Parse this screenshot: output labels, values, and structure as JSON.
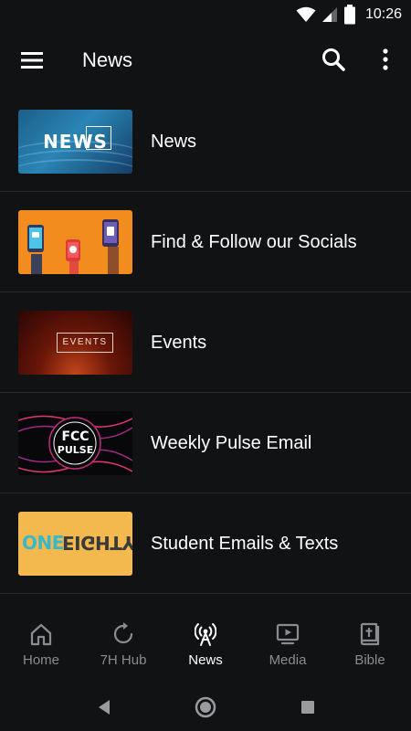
{
  "status_bar": {
    "time": "10:26",
    "icons": [
      "wifi-icon",
      "signal-icon",
      "battery-icon"
    ]
  },
  "app_bar": {
    "title": "News",
    "icons": [
      "menu-icon",
      "search-icon",
      "more-vert-icon"
    ]
  },
  "list": {
    "items": [
      {
        "label": "News",
        "thumb_text": "NEWS"
      },
      {
        "label": "Find & Follow our Socials"
      },
      {
        "label": "Events",
        "thumb_text": "EVENTS"
      },
      {
        "label": "Weekly Pulse Email",
        "thumb_text_line1": "FCC",
        "thumb_text_line2": "PULSE"
      },
      {
        "label": "Student Emails & Texts",
        "thumb_text_left": "ONE",
        "thumb_text_right": "EIGHTY"
      }
    ]
  },
  "bottom_nav": {
    "items": [
      {
        "label": "Home",
        "icon": "home-icon",
        "active": false
      },
      {
        "label": "7H Hub",
        "icon": "refresh-icon",
        "active": false
      },
      {
        "label": "News",
        "icon": "broadcast-icon",
        "active": true
      },
      {
        "label": "Media",
        "icon": "play-screen-icon",
        "active": false
      },
      {
        "label": "Bible",
        "icon": "bible-icon",
        "active": false
      }
    ]
  },
  "colors": {
    "background": "#111214",
    "divider": "#2a2b2e",
    "inactive_text": "#8b8c90",
    "active_text": "#ffffff"
  },
  "system_nav": {
    "icons": [
      "back-icon",
      "home-circle-icon",
      "recents-icon"
    ]
  }
}
